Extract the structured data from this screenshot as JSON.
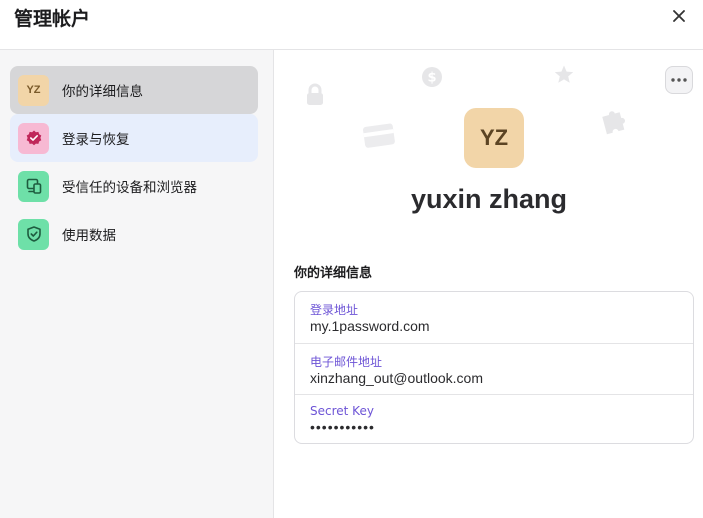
{
  "header": {
    "title": "管理帐户"
  },
  "sidebar": {
    "items": [
      {
        "label": "你的详细信息",
        "icon": "avatar-initials",
        "initials": "YZ"
      },
      {
        "label": "登录与恢复",
        "icon": "shield-check-icon"
      },
      {
        "label": "受信任的设备和浏览器",
        "icon": "devices-icon"
      },
      {
        "label": "使用数据",
        "icon": "shield-icon"
      }
    ]
  },
  "profile": {
    "initials": "YZ",
    "name": "yuxin zhang"
  },
  "details": {
    "title": "你的详细信息",
    "fields": [
      {
        "label": "登录地址",
        "value": "my.1password.com"
      },
      {
        "label": "电子邮件地址",
        "value": "xinzhang_out@outlook.com"
      },
      {
        "label": "Secret Key",
        "value": "•••••••••••"
      }
    ]
  },
  "colors": {
    "accent_label": "#6d54d6",
    "avatar_bg": "#f2d5a8",
    "signin_icon_bg": "#f7b9d3",
    "signin_icon_fg": "#c0275a",
    "devices_icon_bg": "#6ee0a8",
    "usage_icon_bg": "#6ee0a8"
  }
}
